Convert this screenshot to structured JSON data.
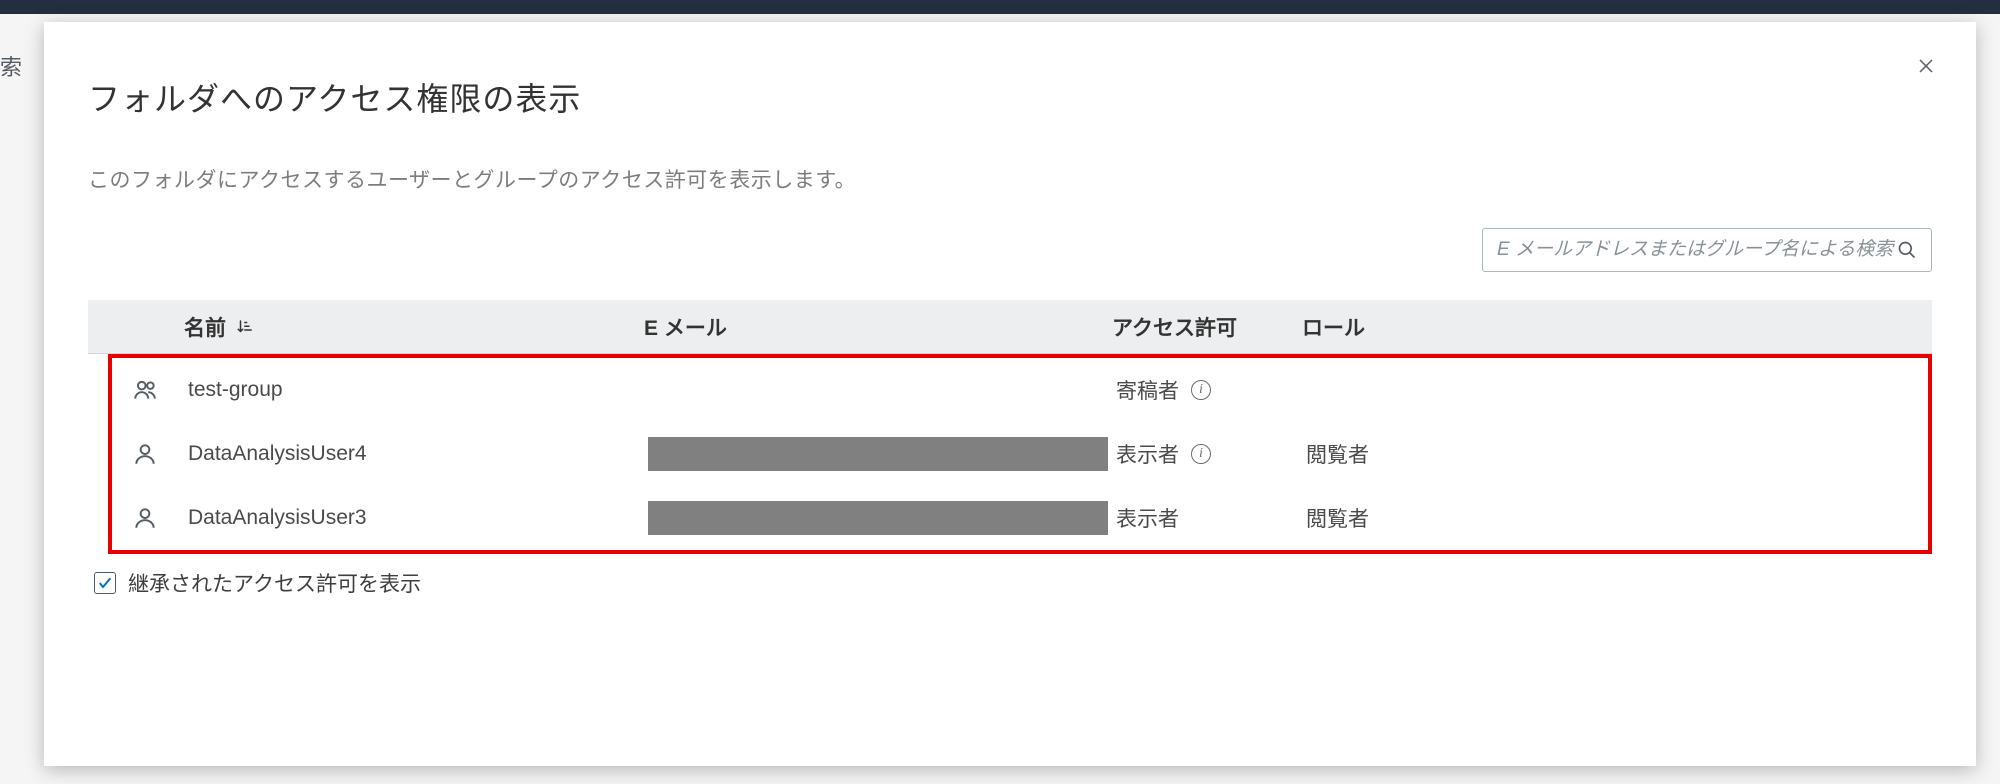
{
  "background": {
    "partial_text": "索"
  },
  "modal": {
    "title": "フォルダへのアクセス権限の表示",
    "subtitle": "このフォルダにアクセスするユーザーとグループのアクセス許可を表示します。",
    "search": {
      "placeholder": "E メールアドレスまたはグループ名による検索"
    },
    "table": {
      "headers": {
        "name": "名前",
        "email": "E メール",
        "permission": "アクセス許可",
        "role": "ロール"
      },
      "rows": [
        {
          "type": "group",
          "name": "test-group",
          "email": "",
          "email_redacted": false,
          "permission": "寄稿者",
          "has_info": true,
          "role": ""
        },
        {
          "type": "user",
          "name": "DataAnalysisUser4",
          "email": "",
          "email_redacted": true,
          "permission": "表示者",
          "has_info": true,
          "role": "閲覧者"
        },
        {
          "type": "user",
          "name": "DataAnalysisUser3",
          "email": "",
          "email_redacted": true,
          "permission": "表示者",
          "has_info": false,
          "role": "閲覧者"
        }
      ]
    },
    "inherited_checkbox": {
      "label": "継承されたアクセス許可を表示",
      "checked": true
    }
  }
}
